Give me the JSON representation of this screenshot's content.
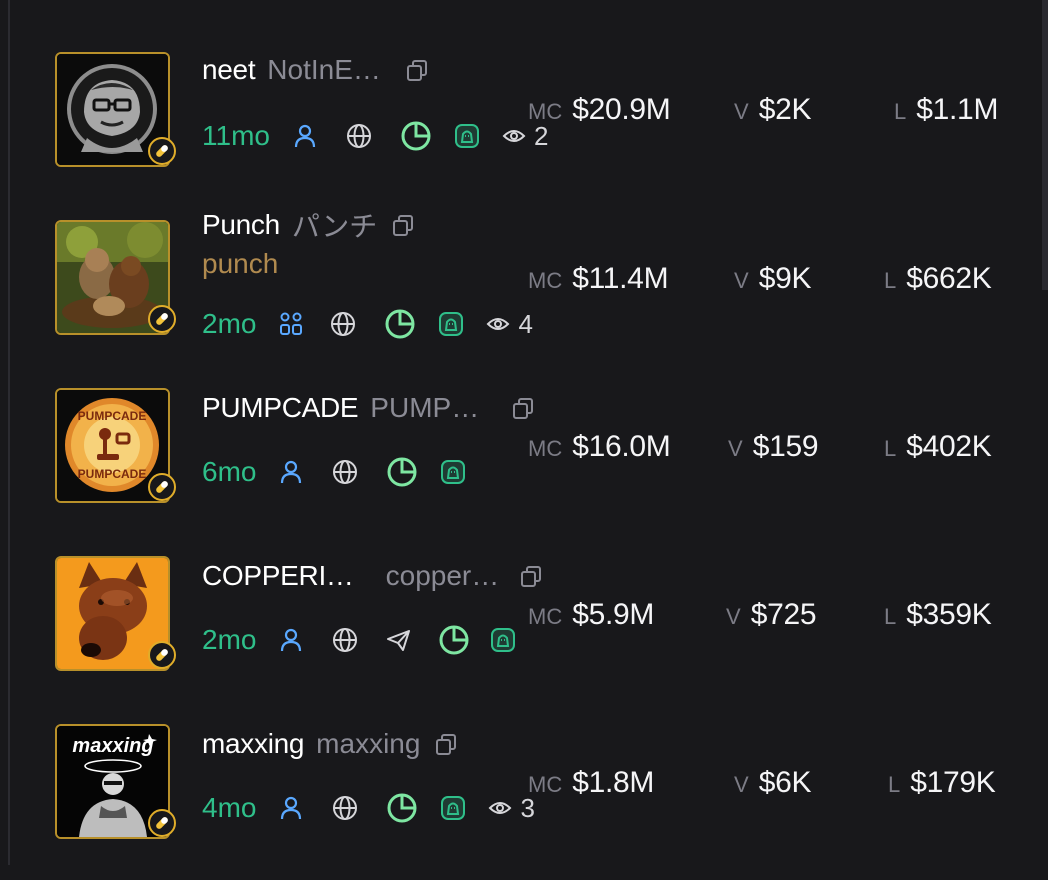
{
  "colors": {
    "age": "#2fbf8a",
    "social": "#5aa8ff",
    "pie": "#7ee6a2",
    "bird": "#2fbf8a",
    "gold": "#e0ad2a"
  },
  "stat_labels": {
    "mc": "MC",
    "v": "V",
    "l": "L"
  },
  "tokens": [
    {
      "ticker": "neet",
      "name": "NotInE…",
      "sub": "",
      "age": "11mo",
      "social_icon": "user-icon",
      "telegram": false,
      "views": "2",
      "mc": "$20.9M",
      "vol": "$2K",
      "liq": "$1.1M"
    },
    {
      "ticker": "Punch",
      "name": "パンチ",
      "sub": "punch",
      "age": "2mo",
      "social_icon": "community-icon",
      "telegram": false,
      "views": "4",
      "mc": "$11.4M",
      "vol": "$9K",
      "liq": "$662K"
    },
    {
      "ticker": "PUMPCADE",
      "name": "PUMP…",
      "sub": "",
      "age": "6mo",
      "social_icon": "user-icon",
      "telegram": false,
      "views": "",
      "mc": "$16.0M",
      "vol": "$159",
      "liq": "$402K"
    },
    {
      "ticker": "COPPERI…",
      "name": "copper…",
      "sub": "",
      "age": "2mo",
      "social_icon": "user-icon",
      "telegram": true,
      "views": "",
      "mc": "$5.9M",
      "vol": "$725",
      "liq": "$359K"
    },
    {
      "ticker": "maxxing",
      "name": "maxxing",
      "sub": "",
      "age": "4mo",
      "social_icon": "user-icon",
      "telegram": false,
      "views": "3",
      "mc": "$1.8M",
      "vol": "$6K",
      "liq": "$179K"
    }
  ],
  "avatar_texts": {
    "pumpcade_top": "PUMPCADE",
    "pumpcade_bottom": "PUMPCADE",
    "maxxing_logo": "maxxing"
  }
}
